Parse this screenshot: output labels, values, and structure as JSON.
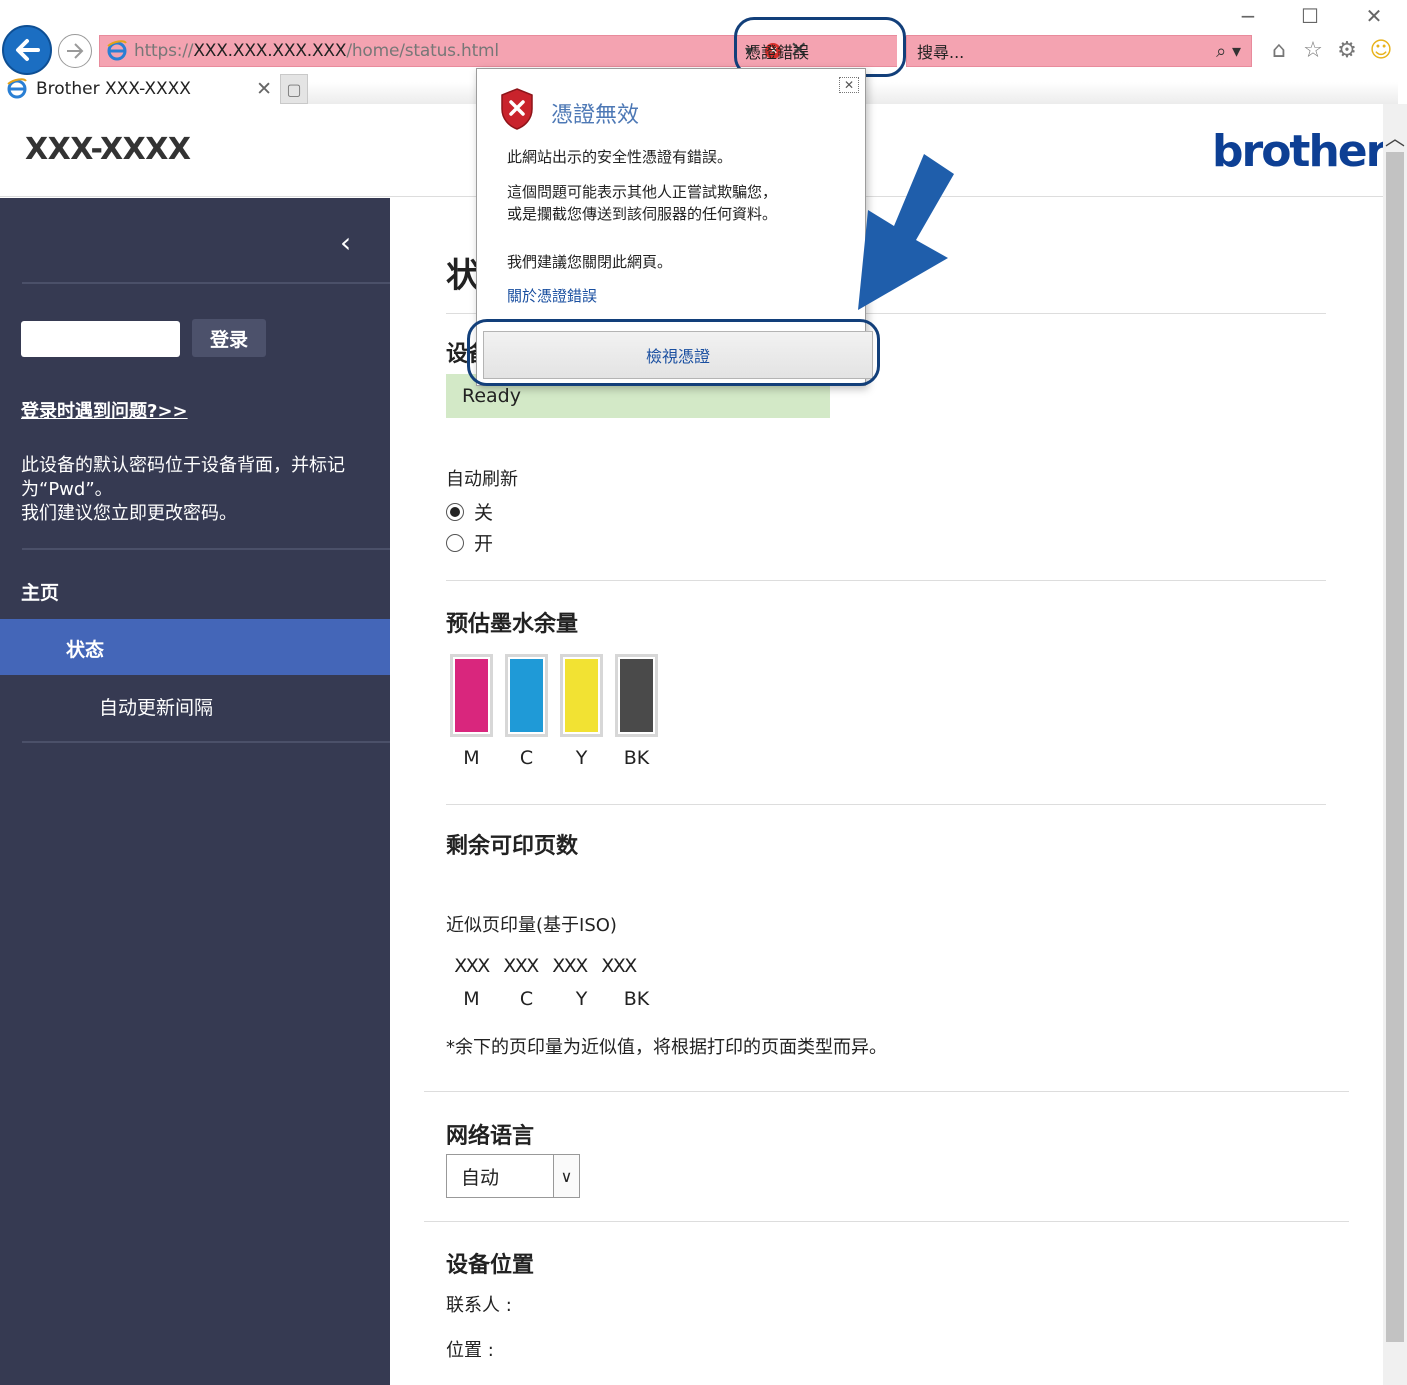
{
  "browser": {
    "url_prefix": "https://",
    "url_host": "XXX.XXX.XXX.XXX",
    "url_path": "/home/status.html",
    "cert_error_label": "憑證錯誤",
    "search_placeholder": "搜尋...",
    "tab_title": "Brother XXX-XXXX"
  },
  "header": {
    "model": "XXX-XXXX",
    "logo_text": "brother",
    "logo_color": "#0d3f94"
  },
  "sidebar": {
    "login_button": "登录",
    "trouble_link": "登录时遇到问题?>>",
    "password_note": "此设备的默认密码位于设备背面，并标记为“Pwd”。\n我们建议您立即更改密码。",
    "nav": {
      "home": "主页",
      "status": "状态",
      "auto_refresh_interval": "自动更新间隔"
    },
    "bg_color": "#363a52",
    "active_color": "#4466b8"
  },
  "main": {
    "title": "状态",
    "device_status_heading": "设备状态",
    "status_value": "Ready",
    "auto_refresh_label": "自动刷新",
    "radio_off": "关",
    "radio_on": "开",
    "ink_heading": "预估墨水余量",
    "ink": [
      {
        "label": "M",
        "color": "#d9267d"
      },
      {
        "label": "C",
        "color": "#1f9ad7"
      },
      {
        "label": "Y",
        "color": "#f2e233"
      },
      {
        "label": "BK",
        "color": "#4a4a4a"
      }
    ],
    "pages_heading": "剩余可印页数",
    "approx_pages_label": "近似页印量(基于ISO)",
    "pages_values": [
      "XXX",
      "XXX",
      "XXX",
      "XXX"
    ],
    "pages_note": "*余下的页印量为近似值，将根据打印的页面类型而异。",
    "web_language_heading": "网络语言",
    "web_language_value": "自动",
    "device_location_heading": "设备位置",
    "contact_label": "联系人 :",
    "location_label": "位置 :"
  },
  "popup": {
    "title": "憑證無效",
    "line1": "此網站出示的安全性憑證有錯誤。",
    "line2": "這個問題可能表示其他人正嘗試欺騙您，",
    "line3": "或是攔截您傳送到該伺服器的任何資料。",
    "line4": "我們建議您關閉此網頁。",
    "link": "關於憑證錯誤",
    "view_button": "檢視憑證"
  }
}
